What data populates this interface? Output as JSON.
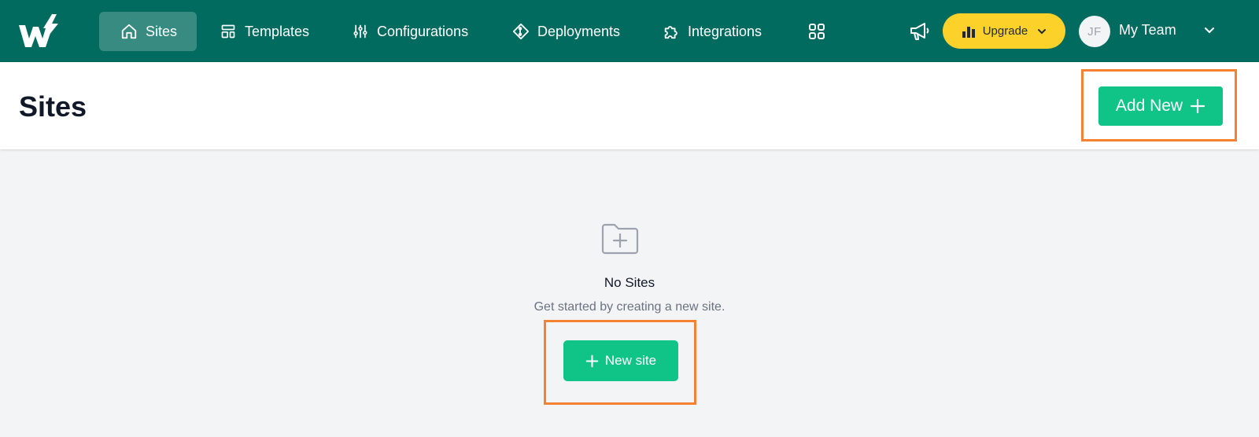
{
  "colors": {
    "nav_bg": "#006b5e",
    "accent_green": "#10c386",
    "upgrade_yellow": "#fcd12a",
    "highlight_orange": "#f58233",
    "page_bg": "#f3f4f6"
  },
  "nav": {
    "logo_icon": "brand-w-bolt-logo",
    "items": [
      {
        "label": "Sites",
        "icon": "home-icon",
        "active": true
      },
      {
        "label": "Templates",
        "icon": "layout-icon"
      },
      {
        "label": "Configurations",
        "icon": "sliders-icon"
      },
      {
        "label": "Deployments",
        "icon": "git-branch-icon"
      },
      {
        "label": "Integrations",
        "icon": "puzzle-icon"
      }
    ],
    "apps_icon": "grid-icon",
    "announcements_icon": "megaphone-icon",
    "upgrade_label": "Upgrade",
    "team": {
      "initials": "JF",
      "name": "My Team"
    }
  },
  "header": {
    "title": "Sites",
    "add_new_label": "Add New"
  },
  "empty_state": {
    "icon": "folder-plus-icon",
    "title": "No Sites",
    "subtitle": "Get started by creating a new site.",
    "button_label": "New site"
  }
}
